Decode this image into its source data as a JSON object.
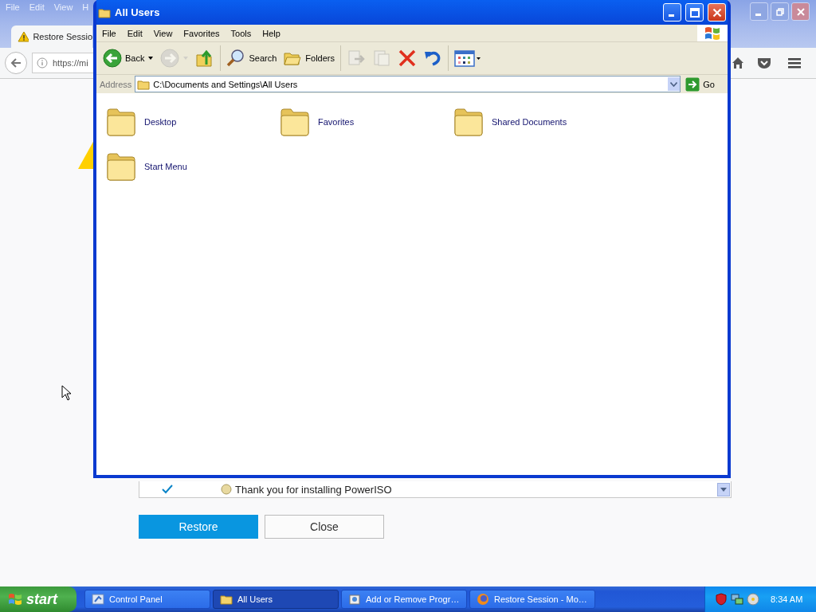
{
  "browser": {
    "menu": [
      "File",
      "Edit",
      "View",
      "H"
    ],
    "tab": {
      "title": "Restore Sessio"
    },
    "url": "https://mi",
    "session_list": {
      "rows": [
        {
          "checked": true,
          "title": "Thank you for installing PowerISO"
        }
      ]
    },
    "buttons": [
      {
        "label": "Restore",
        "kind": "primary"
      },
      {
        "label": "Close",
        "kind": "secondary"
      }
    ]
  },
  "explorer": {
    "title": "All Users",
    "menu": [
      "File",
      "Edit",
      "View",
      "Favorites",
      "Tools",
      "Help"
    ],
    "toolbar": [
      {
        "kind": "back",
        "label": "Back",
        "disabled": false
      },
      {
        "kind": "forward",
        "disabled": true
      },
      {
        "kind": "up",
        "disabled": false
      },
      {
        "kind": "search",
        "label": "Search",
        "disabled": false
      },
      {
        "kind": "folders",
        "label": "Folders",
        "disabled": false
      },
      {
        "kind": "moveto",
        "disabled": true
      },
      {
        "kind": "copyto",
        "disabled": true
      },
      {
        "kind": "delete",
        "disabled": false
      },
      {
        "kind": "undo",
        "disabled": false
      },
      {
        "kind": "views",
        "disabled": false
      }
    ],
    "address": {
      "label": "Address",
      "value": "C:\\Documents and Settings\\All Users"
    },
    "go": "Go",
    "items": [
      {
        "name": "Desktop"
      },
      {
        "name": "Favorites"
      },
      {
        "name": "Shared Documents"
      },
      {
        "name": "Start Menu"
      }
    ]
  },
  "taskbar": {
    "start": "start",
    "tasks": [
      {
        "label": "Control Panel",
        "selected": false,
        "kind": "panel"
      },
      {
        "label": "All Users",
        "selected": true,
        "kind": "folder"
      },
      {
        "label": "Add or Remove Progr…",
        "selected": false,
        "kind": "programs"
      },
      {
        "label": "Restore Session - Mo…",
        "selected": false,
        "kind": "browser"
      }
    ],
    "clock": "8:34 AM"
  }
}
